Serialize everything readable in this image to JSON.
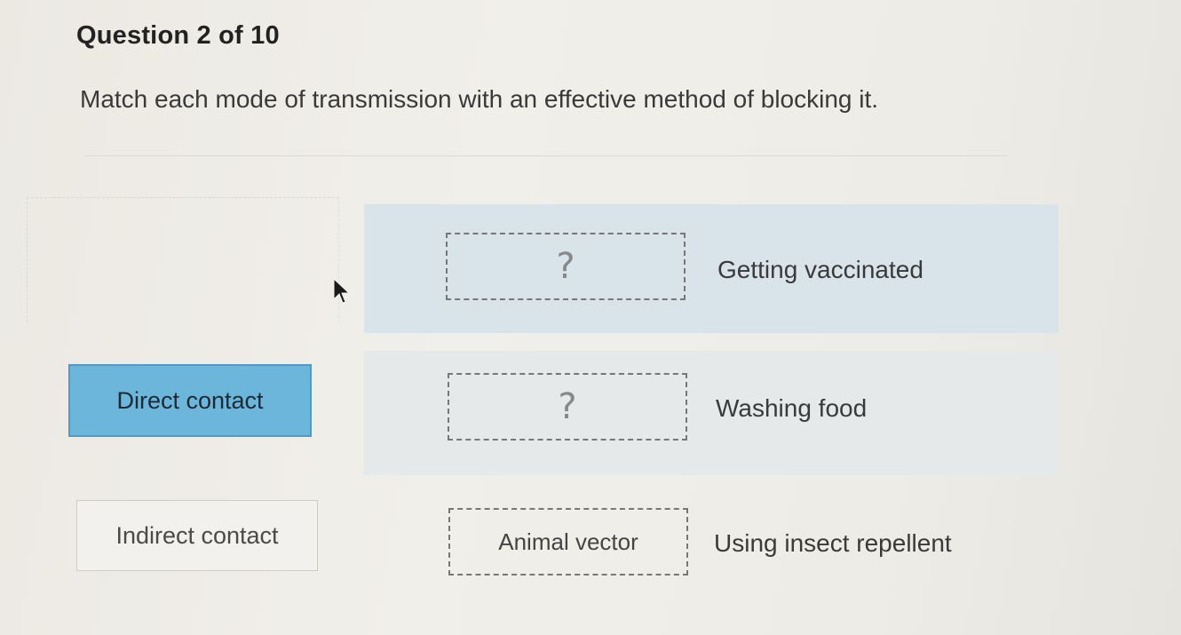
{
  "header": {
    "question_number": "Question 2 of 10",
    "prompt": "Match each mode of transmission with an effective method of blocking it."
  },
  "tiles": [
    {
      "label": "Direct contact",
      "state": "selected"
    },
    {
      "label": "Indirect contact",
      "state": "default"
    }
  ],
  "rows": [
    {
      "slot": "?",
      "method": "Getting vaccinated"
    },
    {
      "slot": "?",
      "method": "Washing food"
    },
    {
      "slot": "Animal vector",
      "method": "Using insect repellent"
    }
  ],
  "colors": {
    "selected_tile": "#6cb6dc",
    "row_highlight": "#d9e3ea"
  },
  "icons": {
    "pointer": "mouse-pointer-icon"
  }
}
